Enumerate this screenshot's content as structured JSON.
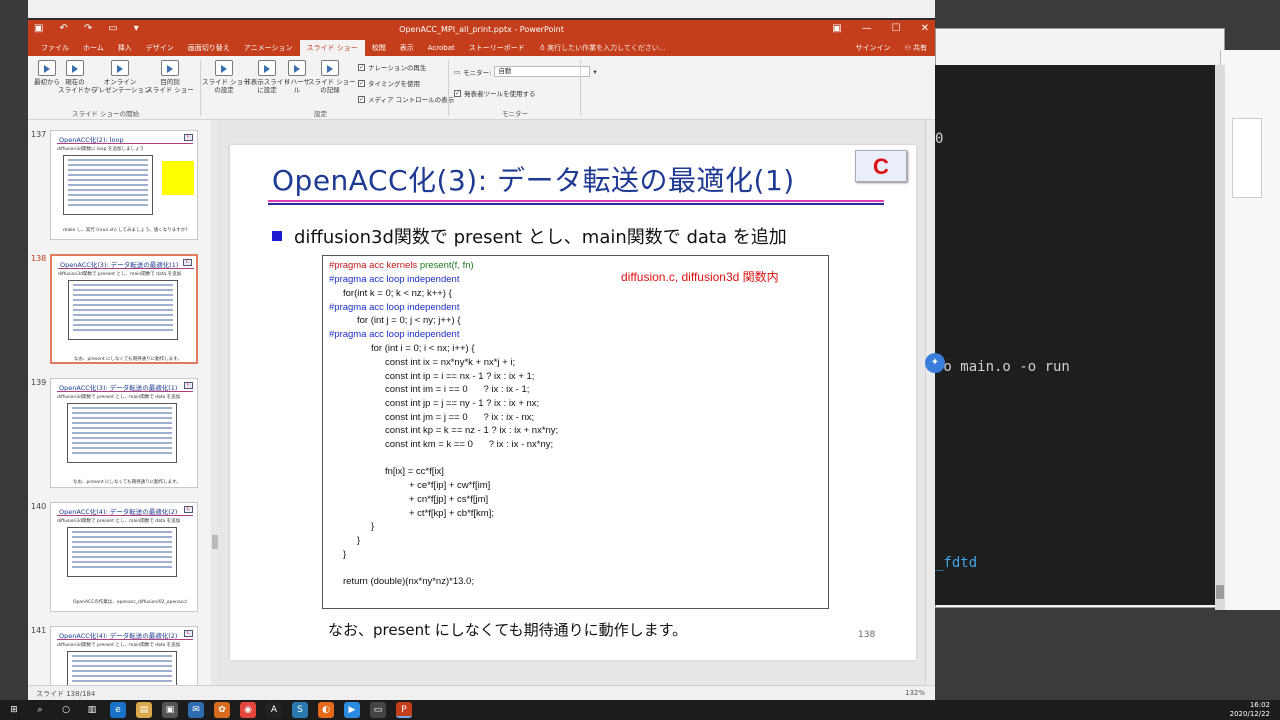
{
  "window": {
    "title": "OpenACC_MPI_all_print.pptx - PowerPoint",
    "min": "—",
    "max": "☐",
    "close": "✕"
  },
  "ribbon_tabs": [
    {
      "label": "ファイル"
    },
    {
      "label": "ホーム"
    },
    {
      "label": "挿入"
    },
    {
      "label": "デザイン"
    },
    {
      "label": "画面切り替え"
    },
    {
      "label": "アニメーション"
    },
    {
      "label": "スライド ショー",
      "active": true
    },
    {
      "label": "校閲"
    },
    {
      "label": "表示"
    },
    {
      "label": "Acrobat"
    },
    {
      "label": "ストーリーボード"
    }
  ],
  "tellme": "実行したい作業を入力してください...",
  "signin": "サインイン",
  "share": "共有",
  "ribbon": {
    "from_start": "最初から",
    "from_current": "現在の\nスライドから",
    "online": "オンライン\nプレゼンテーション",
    "custom": "目的別\nスライド ショー",
    "group_start": "スライド ショーの開始",
    "setup": "スライド ショー\nの設定",
    "hide": "非表示スライド\nに設定",
    "rehearse": "リハーサル",
    "record": "スライド ショー\nの記録",
    "chk_narration": "ナレーションの再生",
    "chk_timing": "タイミングを使用",
    "chk_media": "メディア コントロールの表示",
    "group_setup": "設定",
    "monitor_label": "モニター:",
    "monitor_value": "自動",
    "chk_presenter": "発表者ツールを使用する",
    "group_monitor": "モニター"
  },
  "thumbnails": [
    {
      "num": "137",
      "title": "OpenACC化(2): loop",
      "sub": "diffusion3d関数に loop を追加しましょう",
      "note": "make し、実行 (nrun.sh) してみましょう。速くなりますか?"
    },
    {
      "num": "138",
      "title": "OpenACC化(3): データ転送の最適化(1)",
      "sub": "diffusion3d関数で present とし、main関数で data を追加",
      "note": "なお、present にしなくても期待通りに動作します。"
    },
    {
      "num": "139",
      "title": "OpenACC化(3): データ転送の最適化(1)",
      "sub": "diffusion3d関数で present とし、main関数で data を追加",
      "note": "なお、present にしなくても期待通りに動作します。"
    },
    {
      "num": "140",
      "title": "OpenACC化(4): データ転送の最適化(2)",
      "sub": "diffusion3d関数で present とし、main関数で data を追加",
      "note": "OpenACCの作業は、openacc_diffusion/02_openacc/"
    },
    {
      "num": "141",
      "title": "OpenACC化(4): データ転送の最適化(2)",
      "sub": "diffusion3d関数で present とし、main関数で data を追加",
      "note": ""
    }
  ],
  "slide": {
    "title": "OpenACC化(3): データ転送の最適化(1)",
    "badge": "C",
    "bullet": "diffusion3d関数で present とし、main関数で data を追加",
    "code_note": "diffusion.c, diffusion3d 関数内",
    "code": {
      "l1a": "#pragma acc kernels ",
      "l1b": "present(f, fn)",
      "l2": "#pragma acc loop independent",
      "l3": "for(int k = 0; k < nz; k++) {",
      "l4": "#pragma acc loop independent",
      "l5": "for (int j = 0; j < ny; j++) {",
      "l6": "#pragma acc loop independent",
      "l7": "for (int i = 0; i < nx; i++) {",
      "l8": "const int ix = nx*ny*k + nx*j + i;",
      "l9": "const int ip = i == nx - 1 ? ix : ix + 1;",
      "l10": "const int im = i == 0      ? ix : ix - 1;",
      "l11": "const int jp = j == ny - 1 ? ix : ix + nx;",
      "l12": "const int jm = j == 0      ? ix : ix - nx;",
      "l13": "const int kp = k == nz - 1 ? ix : ix + nx*ny;",
      "l14": "const int km = k == 0      ? ix : ix - nx*ny;",
      "l15": "fn[ix] = cc*f[ix]",
      "l16": "+ ce*f[ip] + cw*f[im]",
      "l17": "+ cn*f[jp] + cs*f[jm]",
      "l18": "+ ct*f[kp] + cb*f[km];",
      "l19": "}",
      "l20": "}",
      "l21": "}",
      "l22": "return (double)(nx*ny*nz)*13.0;"
    },
    "footer": "なお、present にしなくても期待通りに動作します。",
    "page_number": "138"
  },
  "statusbar": {
    "left": "スライド 138/184",
    "right": "132%"
  },
  "terminal": {
    "line1": "0",
    "line2": ".o main.o -o run",
    "line3": "_fdtd"
  },
  "clock": {
    "time": "16:02",
    "date": "2020/12/22"
  },
  "colors": {
    "ppt_accent": "#c43e1c",
    "slide_title": "#1f3a93",
    "badge_text": "#dd1111"
  }
}
